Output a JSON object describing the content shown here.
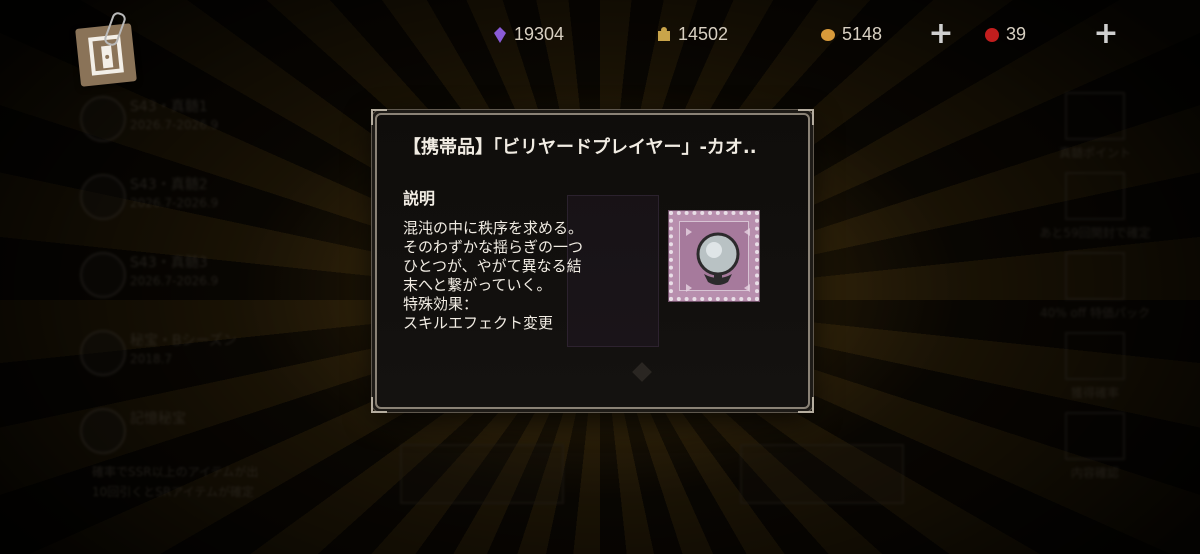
{
  "currencies": [
    {
      "name": "purple-crystal",
      "value": "19304",
      "color": "#8a5bd6"
    },
    {
      "name": "puzzle-piece",
      "value": "14502",
      "color": "#c9a44a"
    },
    {
      "name": "bell-coin",
      "value": "5148",
      "color": "#d89a3a"
    },
    {
      "name": "red-seal",
      "value": "39",
      "color": "#c21e1e"
    }
  ],
  "background": {
    "left_list": [
      {
        "title": "S43・真髄1",
        "date": "2026.7-2026.9"
      },
      {
        "title": "S43・真髄2",
        "date": "2026.7-2026.9"
      },
      {
        "title": "S43・真髄3",
        "date": "2026.7-2026.9"
      },
      {
        "title": "秘宝・Bシーズン",
        "date": "2018.7"
      },
      {
        "title": "記憶秘宝",
        "date": ""
      }
    ],
    "left_note": [
      "確率でSSR以上のアイテムが出",
      "10回引くとSRアイテムが確定"
    ],
    "right_list": [
      {
        "label": "真髄ポイント"
      },
      {
        "label": "あと59回開封で確定"
      },
      {
        "label": "40% off 特価パック"
      },
      {
        "label": "獲得確率"
      },
      {
        "label": "内容確認"
      }
    ]
  },
  "modal": {
    "title": "【携帯品】「ビリヤードプレイヤー」-カオ..",
    "section_label": "説明",
    "description_lines": [
      "混沌の中に秩序を求める。",
      "そのわずかな揺らぎの一つ",
      "ひとつが、やがて異なる結",
      "末へと繋がっていく。",
      "特殊効果：",
      "スキルエフェクト変更"
    ],
    "item_icon": "crystal-ball-stamp-icon"
  }
}
